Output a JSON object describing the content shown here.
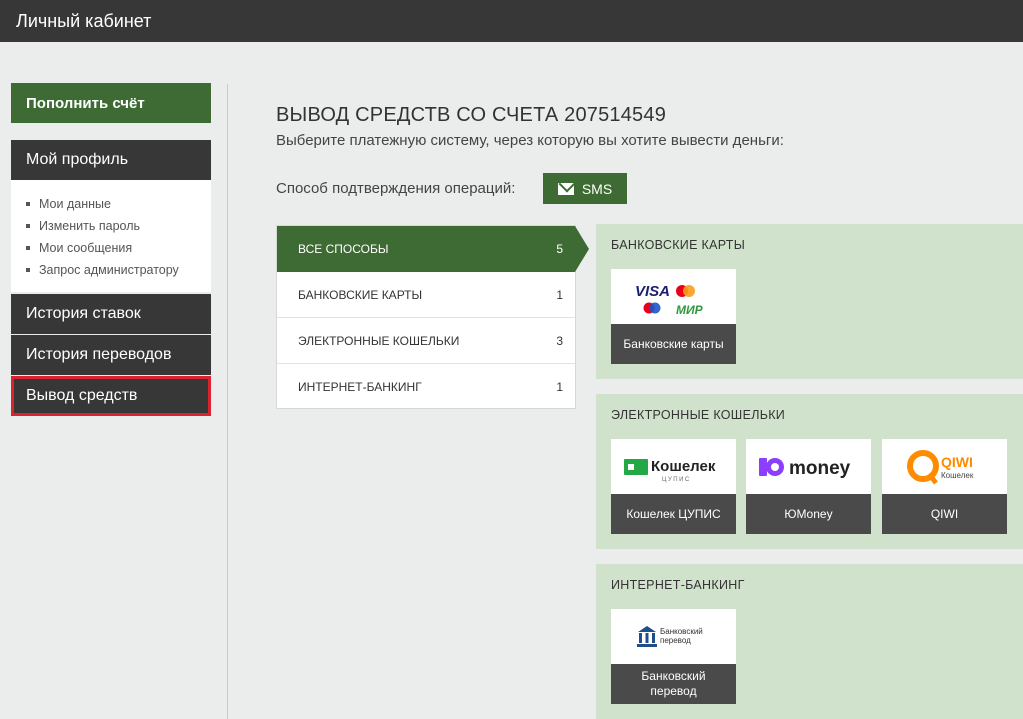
{
  "header": {
    "title": "Личный кабинет"
  },
  "sidebar": {
    "topup": "Пополнить счёт",
    "profile": "Мой профиль",
    "links": [
      "Мои данные",
      "Изменить пароль",
      "Мои сообщения",
      "Запрос администратору"
    ],
    "history_bets": "История ставок",
    "history_transfers": "История переводов",
    "withdraw": "Вывод средств"
  },
  "main": {
    "title": "ВЫВОД СРЕДСТВ СО СЧЕТА 207514549",
    "subtitle": "Выберите платежную систему, через которую вы хотите вывести деньги:",
    "confirm_label": "Способ подтверждения операций:",
    "sms_label": "SMS"
  },
  "filters": [
    {
      "label": "Все способы",
      "count": "5",
      "active": true
    },
    {
      "label": "Банковские карты",
      "count": "1",
      "active": false
    },
    {
      "label": "Электронные кошельки",
      "count": "3",
      "active": false
    },
    {
      "label": "Интернет-банкинг",
      "count": "1",
      "active": false
    }
  ],
  "groups": [
    {
      "title": "Банковские карты",
      "cards": [
        {
          "label": "Банковские карты",
          "logo": "card-brands-icon"
        }
      ]
    },
    {
      "title": "Электронные кошельки",
      "cards": [
        {
          "label": "Кошелек ЦУПИС",
          "logo": "koshelek-tsupis-icon",
          "logo_text": "Кошелек",
          "logo_sub": "ЦУПИС"
        },
        {
          "label": "ЮMoney",
          "logo": "yoomoney-icon",
          "logo_text": "money"
        },
        {
          "label": "QIWI",
          "logo": "qiwi-icon",
          "logo_text": "QIWI",
          "logo_sub": "Кошелек"
        }
      ]
    },
    {
      "title": "Интернет-банкинг",
      "cards": [
        {
          "label": "Банковский перевод",
          "logo": "bank-transfer-icon",
          "logo_text": "Банковский перевод"
        }
      ]
    }
  ],
  "brand_logos": {
    "visa": "VISA",
    "mir": "МИР"
  },
  "colors": {
    "primary_green": "#3e6b34",
    "dark": "#373737",
    "group_bg": "#d1e2cc",
    "highlight_red": "#d9232e"
  }
}
